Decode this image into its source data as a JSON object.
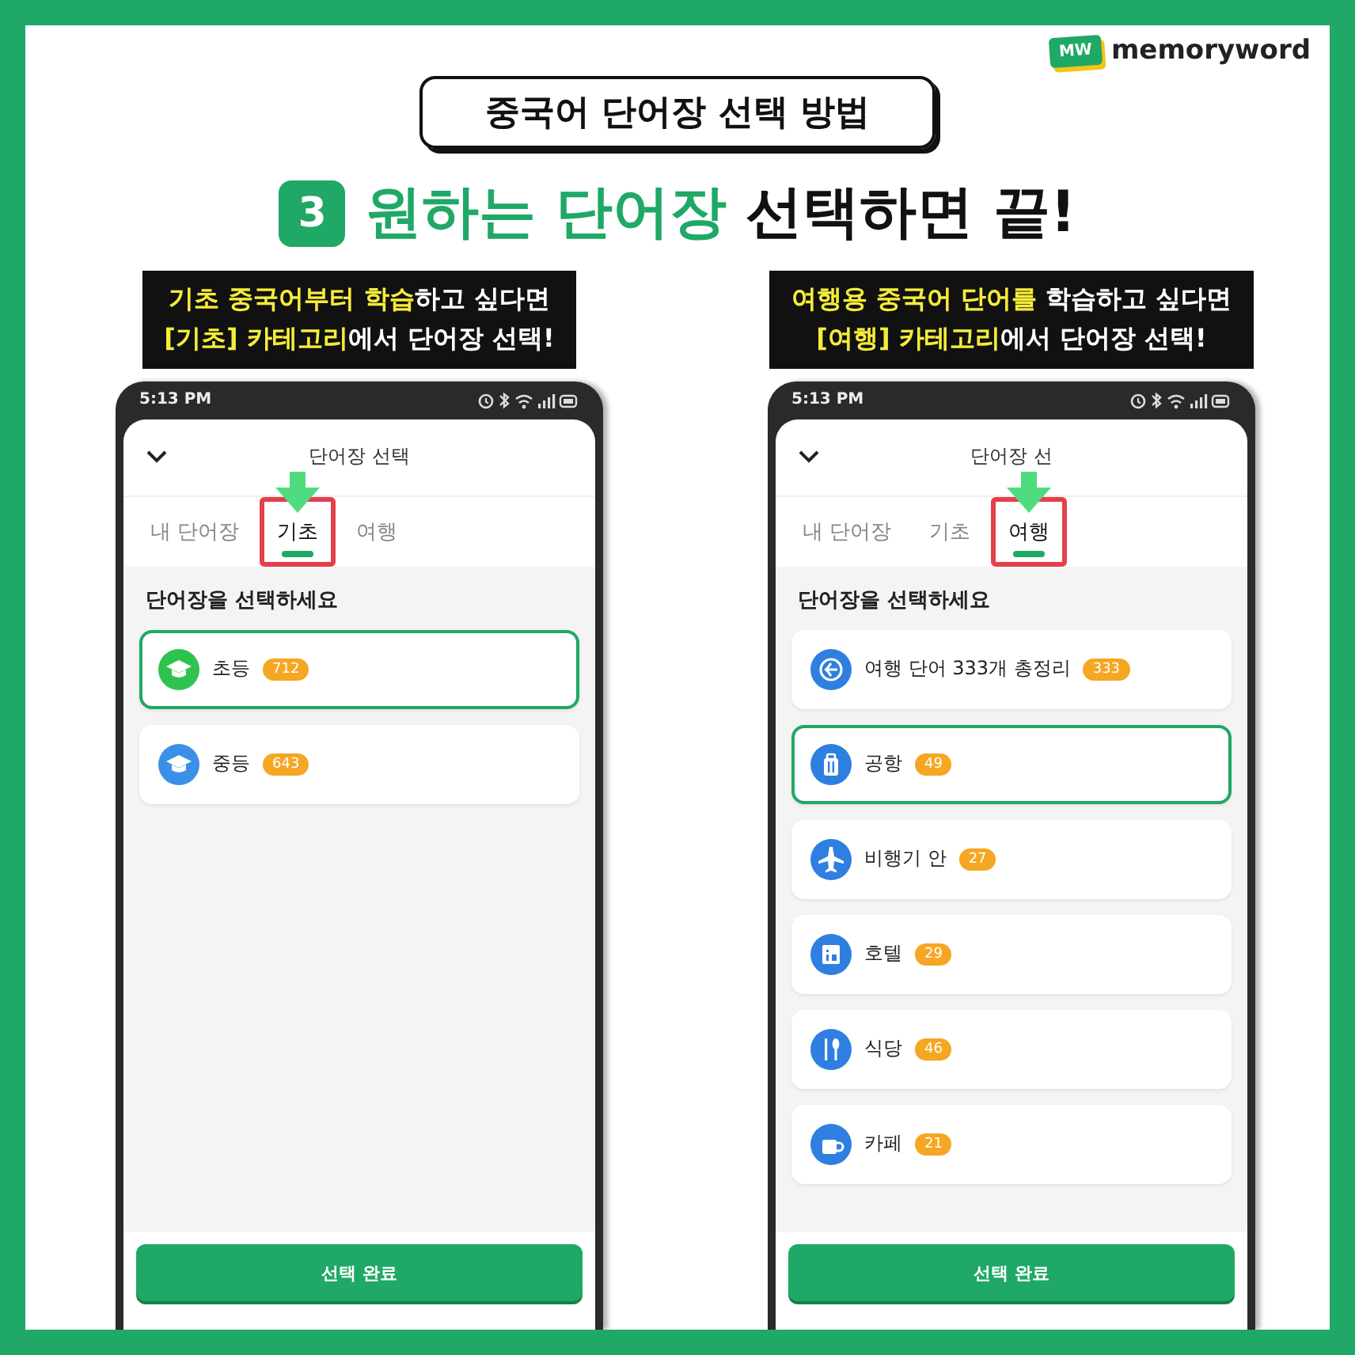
{
  "brand": {
    "badge": "MW",
    "name": "memoryword"
  },
  "title": "중국어 단어장 선택 방법",
  "headline": {
    "step": "3",
    "accent": "원하는 단어장",
    "rest": "선택하면 끝!"
  },
  "panels": [
    {
      "callout": [
        "**기초 중국어부터 학습**하고 싶다면",
        "**[기초] 카테고리**에서 단어장 선택!"
      ],
      "phone": {
        "time": "5:13 PM",
        "title": "단어장 선택",
        "tabs": [
          {
            "label": "내 단어장",
            "selected": false
          },
          {
            "label": "기초",
            "selected": true
          },
          {
            "label": "여행",
            "selected": false
          }
        ],
        "section": "단어장을 선택하세요",
        "items": [
          {
            "kind": "cap",
            "name": "초등",
            "count": "712",
            "color": "#2fc24e",
            "selected": true
          },
          {
            "kind": "cap",
            "name": "중등",
            "count": "643",
            "color": "#3b8fe6",
            "selected": false
          }
        ],
        "button": "선택 완료"
      }
    },
    {
      "callout": [
        "**여행용 중국어 단어를** 학습하고 싶다면",
        "**[여행] 카테고리**에서 단어장 선택!"
      ],
      "phone": {
        "time": "5:13 PM",
        "title": "단어장 선",
        "tabs": [
          {
            "label": "내 단어장",
            "selected": false
          },
          {
            "label": "기초",
            "selected": false
          },
          {
            "label": "여행",
            "selected": true
          }
        ],
        "section": "단어장을 선택하세요",
        "items": [
          {
            "kind": "globe",
            "name": "여행 단어 333개 총정리",
            "count": "333",
            "color": "#2f7fe0",
            "selected": false
          },
          {
            "kind": "suitcase",
            "name": "공항",
            "count": "49",
            "color": "#2f7fe0",
            "selected": true
          },
          {
            "kind": "plane",
            "name": "비행기 안",
            "count": "27",
            "color": "#2f7fe0",
            "selected": false
          },
          {
            "kind": "building",
            "name": "호텔",
            "count": "29",
            "color": "#2f7fe0",
            "selected": false
          },
          {
            "kind": "utensils",
            "name": "식당",
            "count": "46",
            "color": "#2f7fe0",
            "selected": false
          },
          {
            "kind": "cup",
            "name": "카페",
            "count": "21",
            "color": "#2f7fe0",
            "selected": false
          }
        ],
        "button": "선택 완료"
      }
    }
  ]
}
